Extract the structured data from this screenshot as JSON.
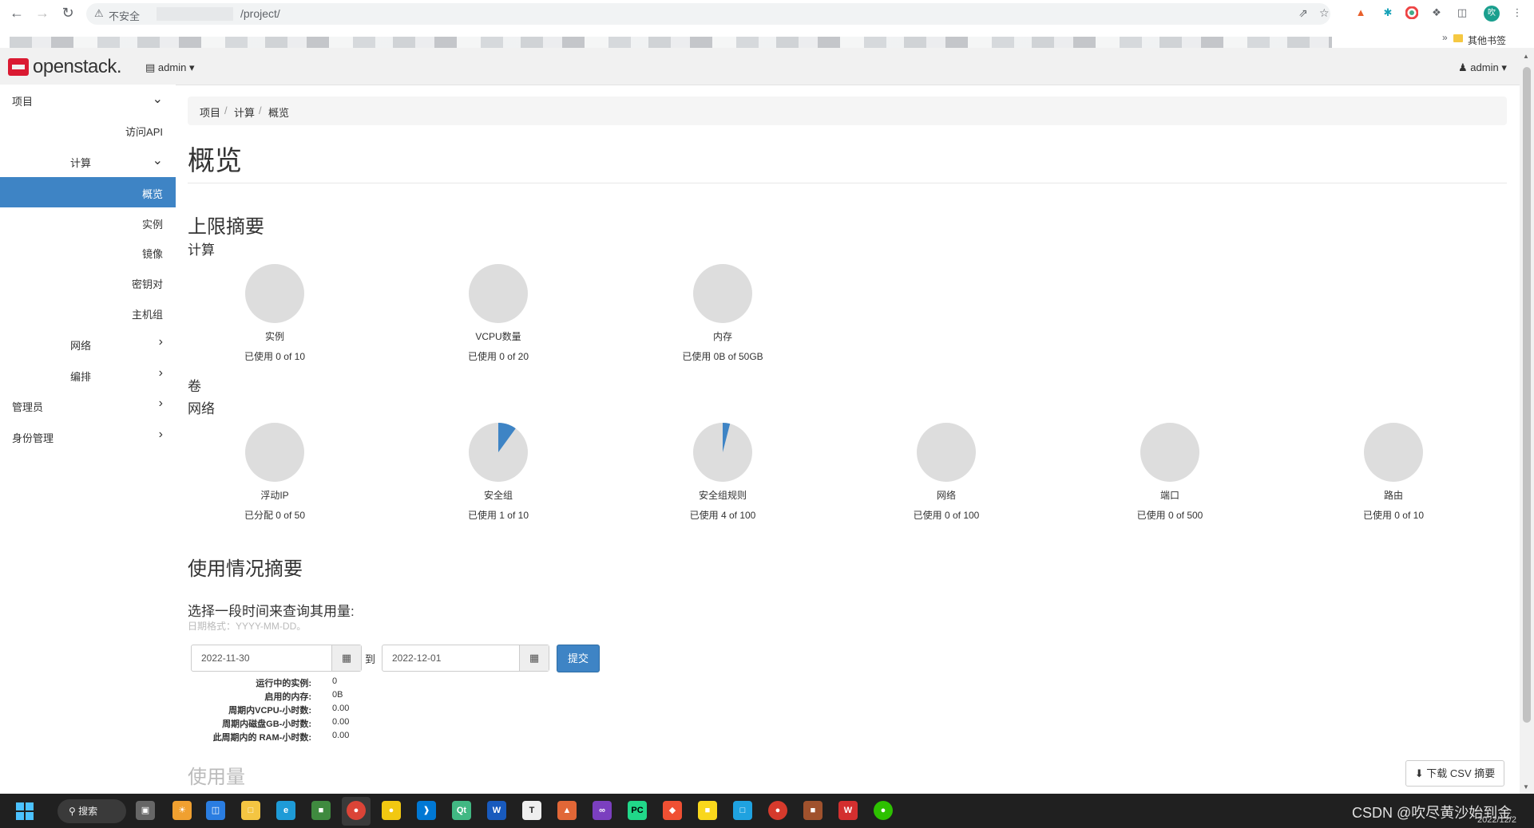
{
  "browser": {
    "security_label": "不安全",
    "url_path": "/project/",
    "other_bookmarks": "其他书签",
    "profile_initial": "吹"
  },
  "header": {
    "logo_text": "openstack.",
    "project_label": "admin",
    "user_label": "admin"
  },
  "sidebar": {
    "items": [
      {
        "label": "项目",
        "level": 0,
        "chevron": "down"
      },
      {
        "label": "访问API",
        "level": 2
      },
      {
        "label": "计算",
        "level": 1,
        "chevron": "down"
      },
      {
        "label": "概览",
        "level": 2,
        "active": true
      },
      {
        "label": "实例",
        "level": 2
      },
      {
        "label": "镜像",
        "level": 2
      },
      {
        "label": "密钥对",
        "level": 2
      },
      {
        "label": "主机组",
        "level": 2
      },
      {
        "label": "网络",
        "level": 1,
        "chevron": "right"
      },
      {
        "label": "编排",
        "level": 1,
        "chevron": "right"
      },
      {
        "label": "管理员",
        "level": 0,
        "chevron": "right"
      },
      {
        "label": "身份管理",
        "level": 0,
        "chevron": "right"
      }
    ]
  },
  "breadcrumb": [
    "项目",
    "计算",
    "概览"
  ],
  "page_title": "概览",
  "limits": {
    "heading": "上限摘要",
    "compute_heading": "计算",
    "volume_heading": "卷",
    "network_heading": "网络",
    "compute": [
      {
        "name": "实例",
        "usage": "已使用 0 of 10",
        "used_fraction": 0.0
      },
      {
        "name": "VCPU数量",
        "usage": "已使用 0 of 20",
        "used_fraction": 0.0
      },
      {
        "name": "内存",
        "usage": "已使用 0B of 50GB",
        "used_fraction": 0.0
      }
    ],
    "network": [
      {
        "name": "浮动IP",
        "usage": "已分配 0 of 50",
        "used_fraction": 0.0
      },
      {
        "name": "安全组",
        "usage": "已使用 1 of 10",
        "used_fraction": 0.1
      },
      {
        "name": "安全组规则",
        "usage": "已使用 4 of 100",
        "used_fraction": 0.04
      },
      {
        "name": "网络",
        "usage": "已使用 0 of 100",
        "used_fraction": 0.0
      },
      {
        "name": "端口",
        "usage": "已使用 0 of 500",
        "used_fraction": 0.0
      },
      {
        "name": "路由",
        "usage": "已使用 0 of 10",
        "used_fraction": 0.0
      }
    ],
    "pie_bg_color": "#dddddd",
    "pie_fill_color": "#3e84c5"
  },
  "usage": {
    "heading": "使用情况摘要",
    "prompt": "选择一段时间来查询其用量:",
    "date_hint": "日期格式：YYYY-MM-DD。",
    "start_date": "2022-11-30",
    "to_label": "到",
    "end_date": "2022-12-01",
    "submit_label": "提交",
    "stats": [
      {
        "key": "运行中的实例:",
        "value": "0"
      },
      {
        "key": "启用的内存:",
        "value": "0B"
      },
      {
        "key": "周期内VCPU-小时数:",
        "value": "0.00"
      },
      {
        "key": "周期内磁盘GB-小时数:",
        "value": "0.00"
      },
      {
        "key": "此周期内的 RAM-小时数:",
        "value": "0.00"
      }
    ],
    "usage_heading": "使用量",
    "csv_button": "下载 CSV 摘要"
  },
  "taskbar": {
    "search_label": "搜索",
    "watermark": "CSDN @吹尽黄沙始到金",
    "date": "2022/12/2"
  }
}
